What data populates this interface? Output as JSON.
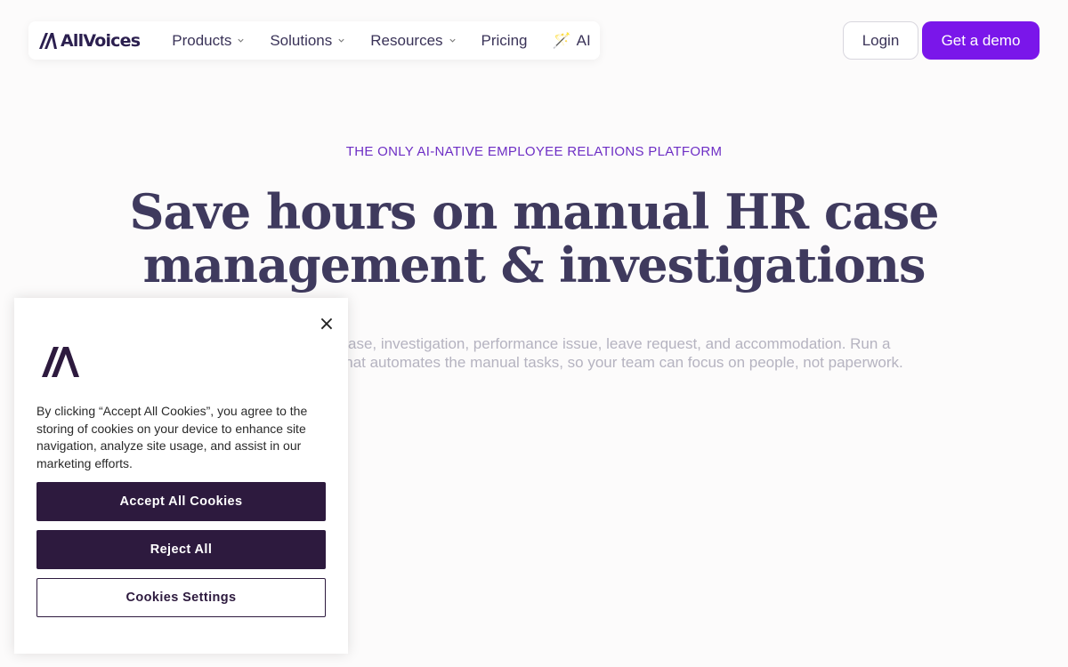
{
  "nav": {
    "brand": "AllVoices",
    "items": [
      {
        "label": "Products"
      },
      {
        "label": "Solutions"
      },
      {
        "label": "Resources"
      },
      {
        "label": "Pricing"
      }
    ],
    "ai": {
      "emoji": "🪄",
      "label": "AI"
    },
    "login_label": "Login",
    "demo_label": "Get a demo"
  },
  "hero": {
    "eyebrow": "THE ONLY AI-NATIVE EMPLOYEE RELATIONS PLATFORM",
    "headline_line1": "Save hours on manual HR case",
    "headline_line2": "management & investigations",
    "sub_line1": "y HR case, investigation, performance issue, leave request, and accommodation. Run a",
    "sub_line2": "ith AI that automates the manual tasks, so your team can focus on people, not paperwork."
  },
  "cookie": {
    "close_glyph": "×",
    "body": "By clicking “Accept All Cookies”, you agree to the storing of cookies on your device to enhance site navigation, analyze site usage, and assist in our marketing efforts.",
    "accept_label": "Accept All Cookies",
    "reject_label": "Reject All",
    "settings_label": "Cookies Settings"
  },
  "colors": {
    "accent": "#7a16ea",
    "eyebrow": "#6e2fc5",
    "headline": "#3f3a5e",
    "cookie_button": "#2d1a3e"
  }
}
